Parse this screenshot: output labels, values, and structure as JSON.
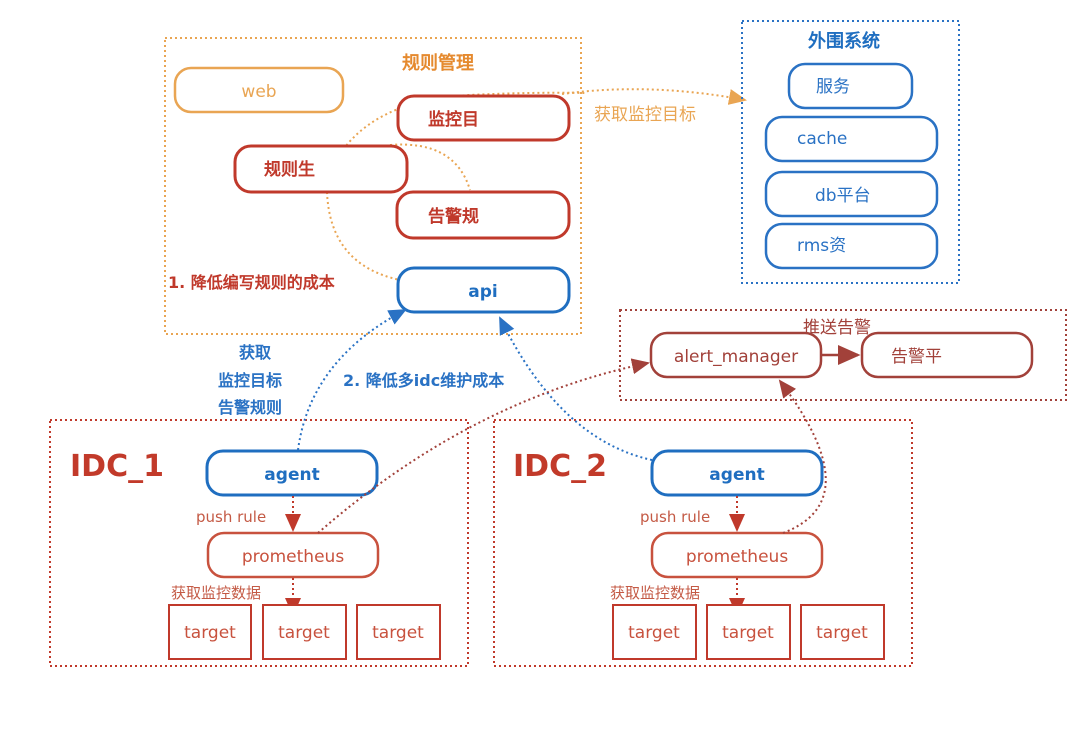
{
  "colors": {
    "orange": "#e9a553",
    "red": "#c0392b",
    "blue": "#1f6ec0",
    "brown": "#a2413a"
  },
  "rule_management": {
    "title": "规则管理",
    "web": "web",
    "monitor_target": "监控目",
    "rule_gen": "规则生",
    "alert_rule": "告警规",
    "api": "api",
    "note": "1. 降低编写规则的成本"
  },
  "external": {
    "title": "外围系统",
    "items": [
      "服务",
      "cache",
      "db平台",
      "rms资"
    ],
    "fetch_label": "获取监控目标"
  },
  "agent_fetch": {
    "line1": "获取",
    "line2": "监控目标",
    "line3": "告警规则"
  },
  "note2": "2. 降低多idc维护成本",
  "alert": {
    "title": "推送告警",
    "manager": "alert_manager",
    "platform": "告警平"
  },
  "idc1": {
    "title": "IDC_1",
    "agent": "agent",
    "push_rule": "push rule",
    "prometheus": "prometheus",
    "fetch_data": "获取监控数据",
    "targets": [
      "target",
      "target",
      "target"
    ]
  },
  "idc2": {
    "title": "IDC_2",
    "agent": "agent",
    "push_rule": "push rule",
    "prometheus": "prometheus",
    "fetch_data": "获取监控数据",
    "targets": [
      "target",
      "target",
      "target"
    ]
  }
}
